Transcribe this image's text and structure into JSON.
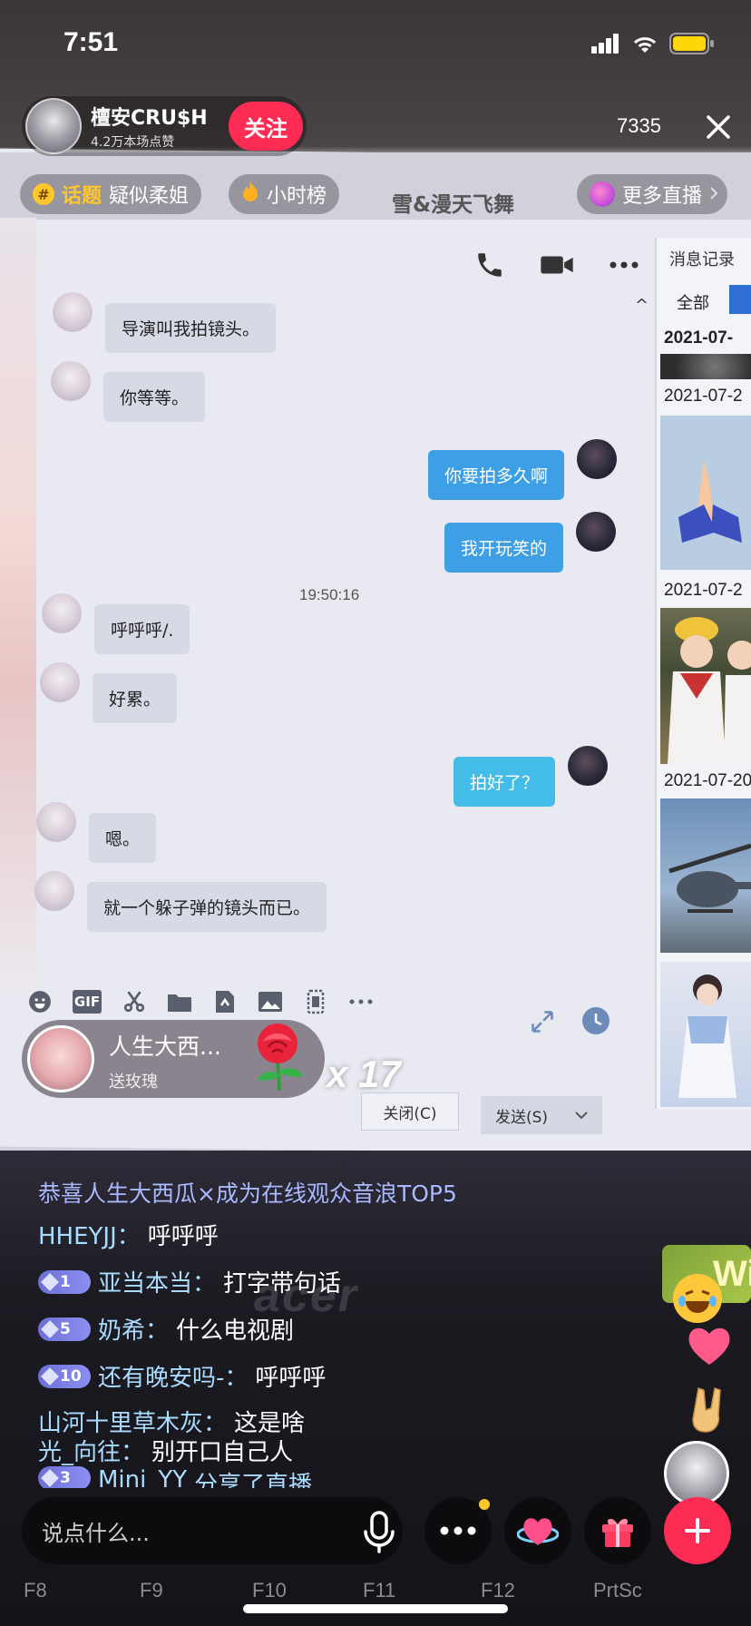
{
  "status_bar": {
    "time": "7:51"
  },
  "host": {
    "name": "檀安CRU$H",
    "likes": "4.2万本场点赞",
    "follow_label": "关注",
    "viewer_count": "7335"
  },
  "tags": {
    "topic_label": "话题",
    "topic_name": "疑似柔姐",
    "hourly_rank": "小时榜",
    "rank_scroller": "雪&漫天飞舞",
    "more_live": "更多直播"
  },
  "screen_chat": {
    "messages": [
      {
        "text": "导演叫我拍镜头。"
      },
      {
        "text": "你等等。"
      },
      {
        "text": "你要拍多久啊"
      },
      {
        "text": "我开玩笑的"
      },
      {
        "text": "呼呼呼/."
      },
      {
        "text": "好累。"
      },
      {
        "text": "拍好了？"
      },
      {
        "text": "嗯。"
      },
      {
        "text": "就一个躲子弹的镜头而已。"
      }
    ],
    "timestamp": "19:50:16",
    "close_label": "关闭(C)",
    "send_label": "发送(S)",
    "right_panel": {
      "title": "消息记录",
      "tab_all": "全部",
      "dates": [
        "2021-07-",
        "2021-07-2",
        "2021-07-2",
        "2021-07-20"
      ]
    },
    "gif_label": "GIF"
  },
  "gift": {
    "sender": "人生大西...",
    "gift_name": "送玫瑰",
    "count": "x 17"
  },
  "comments": {
    "banner": "恭喜人生大西瓜×成为在线观众音浪TOP5",
    "items": [
      {
        "user": "HHEYJJ：",
        "text": "呼呼呼",
        "level": ""
      },
      {
        "user": "亚当本当：",
        "text": "打字带句话",
        "level": "1"
      },
      {
        "user": "奶希：",
        "text": "什么电视剧",
        "level": "5"
      },
      {
        "user": "还有晚安吗-：",
        "text": "呼呼呼",
        "level": "10"
      },
      {
        "user": "山河十里草木灰：",
        "text": "这是啥",
        "level": ""
      },
      {
        "user": "光_向往：",
        "text": "别开口自己人",
        "level": ""
      },
      {
        "user": "Mini_YY",
        "text": "分享了直播",
        "level": "3"
      }
    ]
  },
  "input": {
    "placeholder": "说点什么..."
  },
  "laptop": {
    "brand": "acer",
    "sticker": "Wi",
    "fkeys": [
      "F8",
      "F9",
      "F10",
      "F11",
      "F12",
      "PrtSc"
    ]
  },
  "colors": {
    "accent": "#fe2c55",
    "bubble_out": "#3d9fe6",
    "username": "#a9dcff"
  }
}
